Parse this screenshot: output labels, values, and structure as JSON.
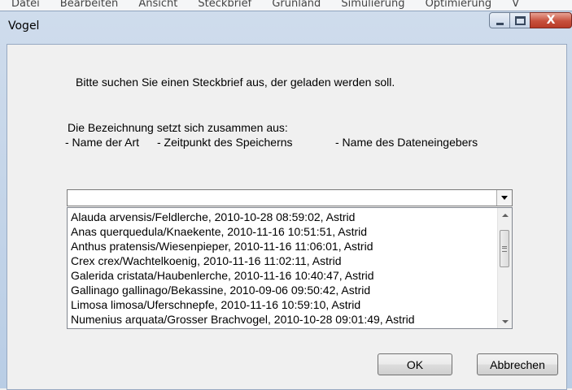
{
  "background_menu": {
    "items": [
      "Datei",
      "Bearbeiten",
      "Ansicht",
      "Steckbrief",
      "Grünland",
      "Simulierung",
      "Optimierung",
      "V"
    ]
  },
  "window": {
    "title": "Vogel",
    "minimize_icon": "minimize-icon",
    "maximize_icon": "maximize-icon",
    "close_glyph": "X"
  },
  "dialog": {
    "instruction": "Bitte suchen Sie einen Steckbrief aus, der geladen werden soll.",
    "legend_title": "Die Bezeichnung setzt sich zusammen aus:",
    "legend_parts": [
      "- Name der Art",
      "- Zeitpunkt des Speicherns",
      "- Name des Dateneingebers"
    ],
    "combo_value": "",
    "list_items": [
      "Alauda arvensis/Feldlerche, 2010-10-28 08:59:02, Astrid",
      "Anas querquedula/Knaekente, 2010-11-16 10:51:51, Astrid",
      "Anthus pratensis/Wiesenpieper, 2010-11-16 11:06:01, Astrid",
      "Crex crex/Wachtelkoenig, 2010-11-16 11:02:11, Astrid",
      "Galerida cristata/Haubenlerche, 2010-11-16 10:40:47, Astrid",
      "Gallinago gallinago/Bekassine, 2010-09-06 09:50:42, Astrid",
      "Limosa limosa/Uferschnepfe, 2010-11-16 10:59:10, Astrid",
      "Numenius arquata/Grosser Brachvogel, 2010-10-28 09:01:49, Astrid"
    ],
    "ok_label": "OK",
    "cancel_label": "Abbrechen"
  },
  "colors": {
    "frame": "#b9cde5",
    "close_button": "#c7503c",
    "client_bg": "#f0f0f0"
  }
}
